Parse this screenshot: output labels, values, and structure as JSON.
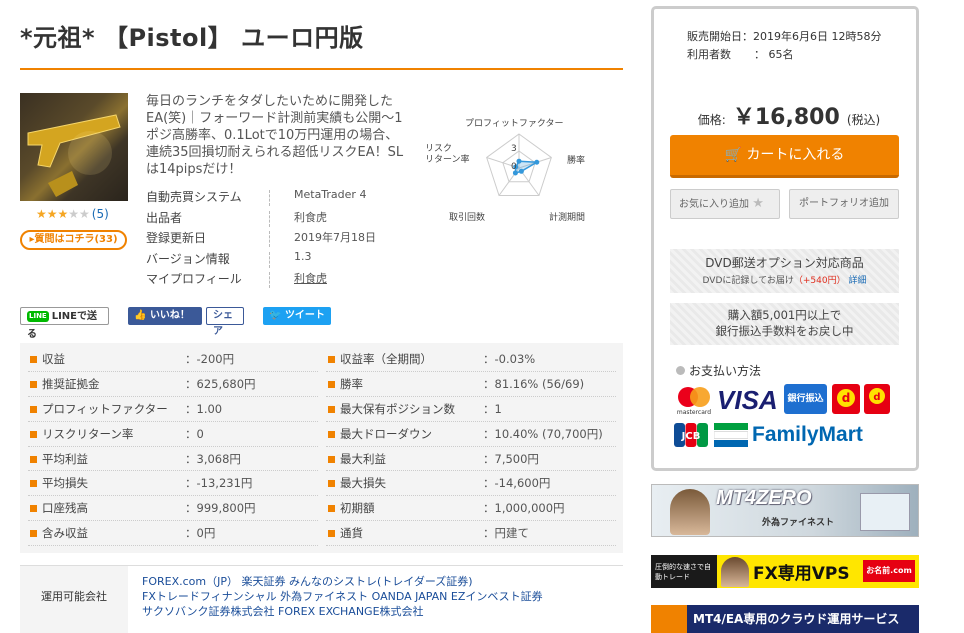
{
  "product": {
    "title": "*元祖* 【Pistol】 ユーロ円版",
    "description": "毎日のランチをタダしたいために開発したEA(笑)｜フォーワード計測前実績も公開～1ポジ高勝率、0.1Lotで10万円運用の場合、連続35回損切耐えられる超低リスクEA！SLは14pipsだけ！",
    "rating_stars": "★★★",
    "rating_stars_off": "★★",
    "rating": 3,
    "rating_max": 5,
    "review_count": "(5)",
    "question_button": "▸質問はコチラ(33)"
  },
  "info": [
    {
      "label": "自動売買システム",
      "value": "MetaTrader 4"
    },
    {
      "label": "出品者",
      "value": "利食虎"
    },
    {
      "label": "登録更新日",
      "value": "2019年7月18日"
    },
    {
      "label": "バージョン情報",
      "value": "1.3"
    },
    {
      "label": "マイプロフィール",
      "value": "利食虎"
    }
  ],
  "radar": {
    "labels": {
      "profit_factor": "プロフィットファクター",
      "win_rate": "勝率",
      "period": "計測期間",
      "trades": "取引回数",
      "risk_return": "リスク\nリターン率"
    },
    "scale_label": "3",
    "scale_zero": "0",
    "scores": {
      "profit_factor": 0.2,
      "win_rate": 0.55,
      "period": 0.12,
      "trades": 0.18,
      "risk_return": 0.1
    }
  },
  "share": {
    "line_badge": "LINE",
    "line_label": "LINEで送る",
    "fb_like": "いいね！ 0",
    "fb_share": "シェア",
    "tweet": "ツイート"
  },
  "stats_left": [
    {
      "label": "収益",
      "value": "：-200円"
    },
    {
      "label": "推奨証拠金",
      "value": "：625,680円"
    },
    {
      "label": "プロフィットファクター",
      "value": "：1.00"
    },
    {
      "label": "リスクリターン率",
      "value": "：0"
    },
    {
      "label": "平均利益",
      "value": "：3,068円"
    },
    {
      "label": "平均損失",
      "value": "：-13,231円"
    },
    {
      "label": "口座残高",
      "value": "：999,800円"
    },
    {
      "label": "含み収益",
      "value": "：0円"
    }
  ],
  "stats_right": [
    {
      "label": "収益率（全期間）",
      "value": "：-0.03%"
    },
    {
      "label": "勝率",
      "value": "：81.16% (56/69)"
    },
    {
      "label": "最大保有ポジション数",
      "value": "：1"
    },
    {
      "label": "最大ドローダウン",
      "value": "：10.40% (70,700円)"
    },
    {
      "label": "最大利益",
      "value": "：7,500円"
    },
    {
      "label": "最大損失",
      "value": "：-14,600円"
    },
    {
      "label": "初期額",
      "value": "：1,000,000円"
    },
    {
      "label": "通貨",
      "value": "：円建て"
    }
  ],
  "brokers": {
    "label": "運用可能会社",
    "line1": "FOREX.com（JP） 楽天証券 みんなのシストレ(トレイダーズ証券)",
    "line2": "FXトレードフィナンシャル 外為ファイネスト OANDA JAPAN EZインベスト証券",
    "line3": "サクソバンク証券株式会社 FOREX EXCHANGE株式会社"
  },
  "sidebar": {
    "start_label": "販売開始日：",
    "start_value": "2019年6月6日 12時58分",
    "users_label": "利用者数",
    "users_value": "： 65名",
    "price_label": "価格:",
    "price_value": "￥16,800",
    "price_tax": "(税込)",
    "cart_button": "カートに入れる",
    "favorite_button": "お気に入り追加",
    "portfolio_button": "ポートフォリオ追加",
    "dvd_title": "DVD郵送オプション対応商品",
    "dvd_sub": "DVDに記録してお届け",
    "dvd_price": "（+540円）",
    "dvd_link": "詳細",
    "bank_line1": "購入額5,001円以上で",
    "bank_line2": "銀行振込手数料をお戻し中",
    "payment_title": "お支払い方法",
    "pay_visa": "VISA",
    "pay_bank": "銀行振込",
    "pay_jcb": "JCB",
    "pay_family": "FamilyMart",
    "pay_mastercard": "mastercard"
  },
  "banners": {
    "mt4_title": "MT4ZERO",
    "mt4_sub": "外為ファイネスト",
    "vps_left": "圧倒的な速さで自動トレード",
    "vps_main": "FX専用VPS",
    "vps_brand": "お名前.com",
    "cloud_text": "MT4/EA専用のクラウド運用サービス"
  }
}
